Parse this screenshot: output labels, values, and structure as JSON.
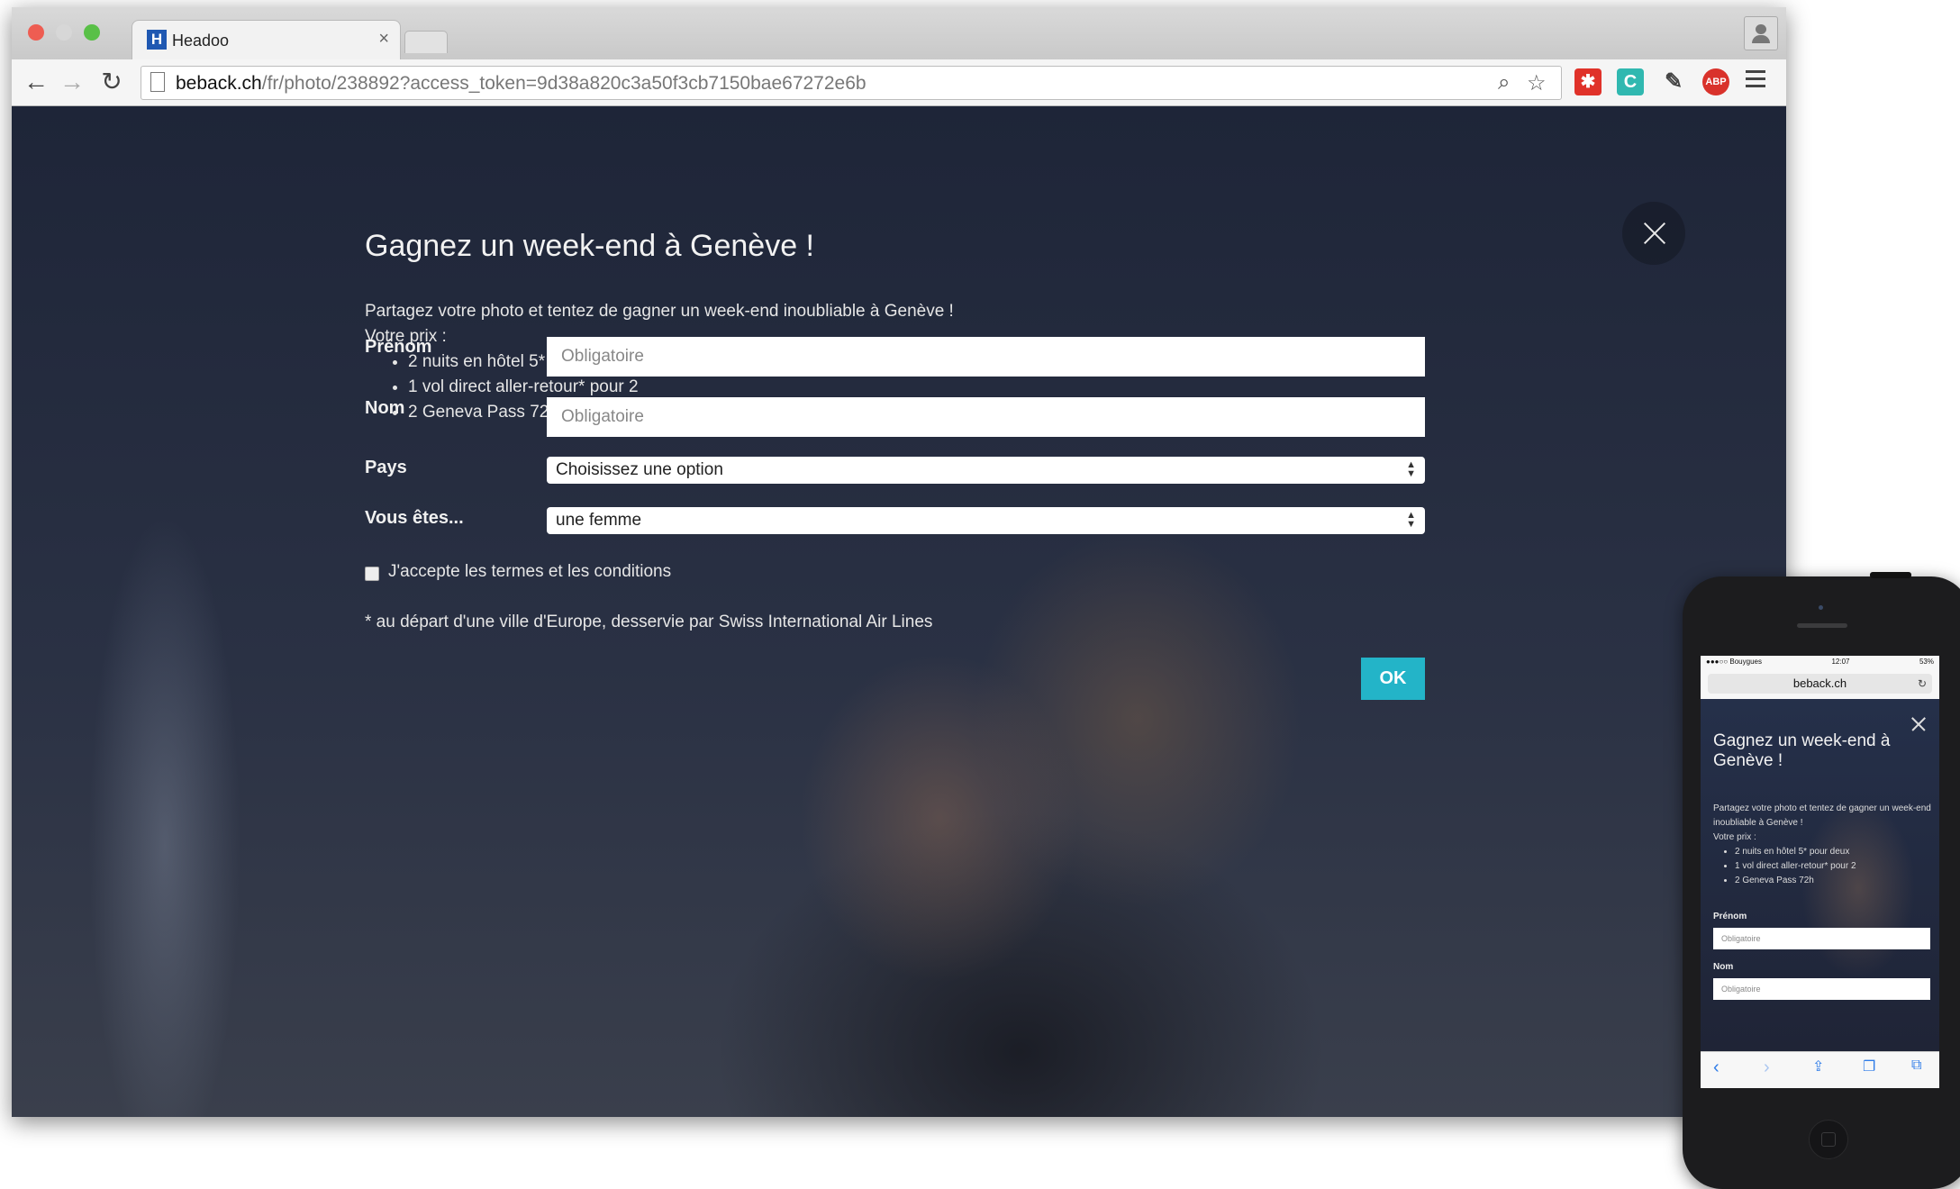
{
  "browser": {
    "tab_title": "Headoo",
    "tab_close": "×",
    "favicon_letter": "H",
    "url_domain": "beback.ch",
    "url_path": "/fr/photo/238892?access_token=9d38a820c3a50f3cb7150bae67272e6b",
    "extensions": [
      "C",
      "ABP"
    ]
  },
  "modal": {
    "title": "Gagnez un week-end à Genève !",
    "intro_line1": "Partagez votre photo et tentez de gagner un week-end inoubliable à Genève !",
    "intro_line2": "Votre prix :",
    "prizes": [
      "2 nuits en hôtel 5* pour deux",
      "1 vol direct aller-retour* pour 2",
      "2 Geneva Pass 72h"
    ],
    "fields": {
      "prenom_label": "Prénom",
      "prenom_placeholder": "Obligatoire",
      "nom_label": "Nom",
      "nom_placeholder": "Obligatoire",
      "pays_label": "Pays",
      "pays_value": "Choisissez une option",
      "sexe_label": "Vous êtes...",
      "sexe_value": "une femme"
    },
    "terms_label": "J'accepte les termes et les conditions",
    "footnote": "* au départ d'une ville d'Europe, desservie par Swiss International Air Lines",
    "ok_label": "OK"
  },
  "phone": {
    "status_carrier": "●●●○○ Bouygues",
    "status_time": "12:07",
    "status_battery": "53%",
    "url": "beback.ch",
    "title": "Gagnez un week-end à Genève !",
    "intro_line1": "Partagez votre photo et tentez de gagner un week-end inoubliable à Genève !",
    "intro_line2": "Votre prix :",
    "prizes": [
      "2 nuits en hôtel 5* pour deux",
      "1 vol direct aller-retour* pour 2",
      "2 Geneva Pass 72h"
    ],
    "prenom_label": "Prénom",
    "prenom_placeholder": "Obligatoire",
    "nom_label": "Nom",
    "nom_placeholder": "Obligatoire"
  },
  "colors": {
    "accent": "#23b4c8",
    "overlay": "#1e2538"
  }
}
